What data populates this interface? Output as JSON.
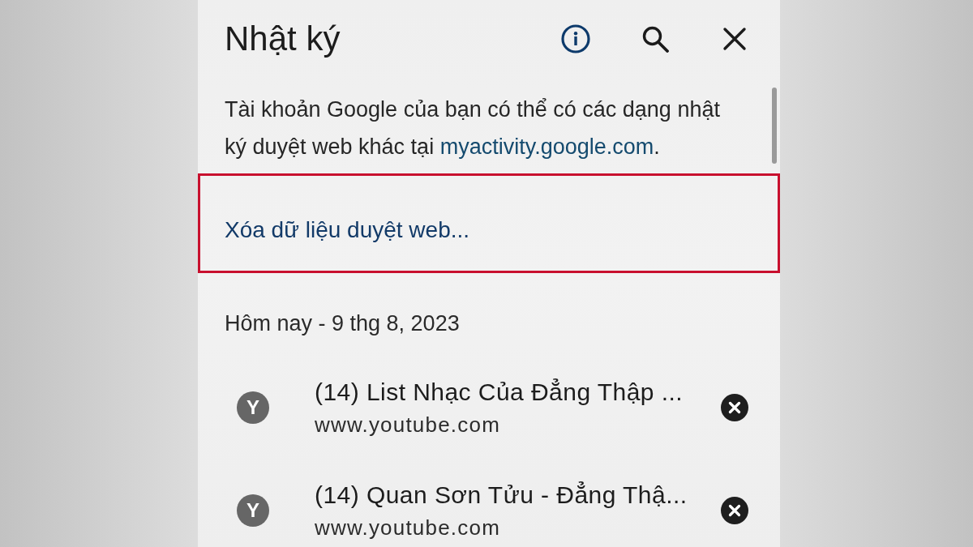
{
  "header": {
    "title": "Nhật ký"
  },
  "notice": {
    "text": "Tài khoản Google của bạn có thể có các dạng nhật ký duyệt web khác tại ",
    "link": "myactivity.google.com",
    "suffix": "."
  },
  "clear_data": {
    "label": "Xóa dữ liệu duyệt web...",
    "highlighted": true
  },
  "date_heading": "Hôm nay - 9 thg 8, 2023",
  "history_items": [
    {
      "favicon_letter": "Y",
      "title": "(14) List Nhạc Của Đẳng Thập ...",
      "url": "www.youtube.com"
    },
    {
      "favicon_letter": "Y",
      "title": "(14) Quan Sơn Tửu - Đẳng Thậ...",
      "url": "www.youtube.com"
    }
  ]
}
